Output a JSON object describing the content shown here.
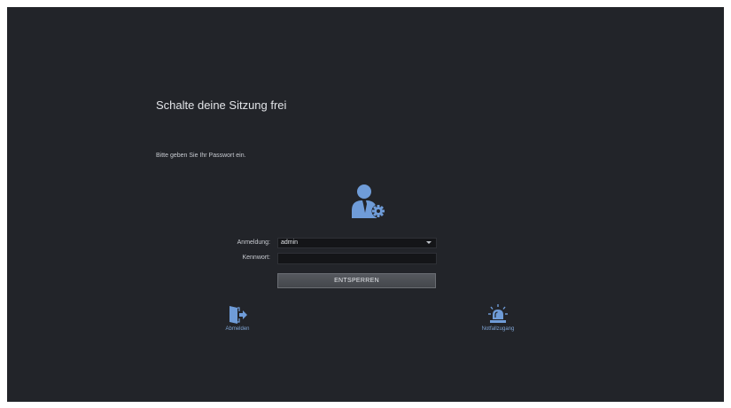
{
  "dialog": {
    "title": "Schalte deine Sitzung frei",
    "instruction": "Bitte geben Sie Ihr Passwort ein.",
    "user_icon": "user-settings-icon"
  },
  "form": {
    "login_label": "Anmeldung:",
    "login_value": "admin",
    "password_label": "Kennwort:",
    "password_value": "",
    "unlock_label": "ENTSPERREN"
  },
  "actions": {
    "logout_label": "Abmelden",
    "logout_icon": "door-exit-icon",
    "emergency_label": "Notfallzugang",
    "emergency_icon": "siren-icon"
  },
  "colors": {
    "background": "#222429",
    "accent": "#6f9cd8",
    "button": "#4b4e54"
  }
}
